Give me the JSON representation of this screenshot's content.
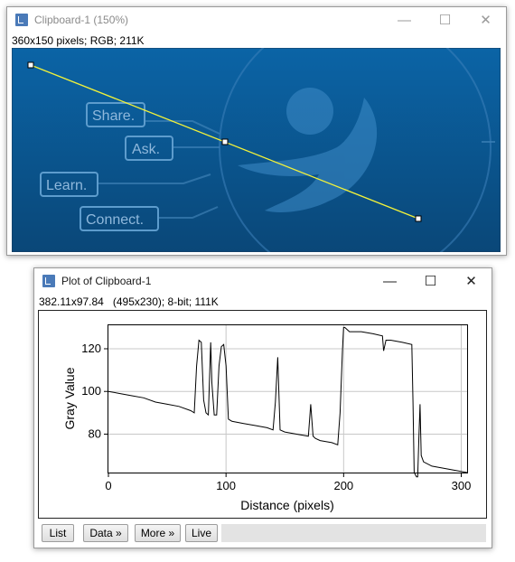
{
  "image_window": {
    "title": "Clipboard-1 (150%)",
    "info": "360x150 pixels; RGB; 211K",
    "controls": {
      "minimize": "—",
      "maximize": "☐",
      "close": "✕"
    },
    "banner": {
      "labels": [
        "Share.",
        "Ask.",
        "Learn.",
        "Connect."
      ],
      "bg_top": "#0b5e9e",
      "bg_bottom": "#0a4a80",
      "line_color": "#f2f23a"
    }
  },
  "plot_window": {
    "title": "Plot of Clipboard-1",
    "info": "382.11x97.84   (495x230); 8-bit; 111K",
    "controls": {
      "minimize": "—",
      "maximize": "☐",
      "close": "✕"
    },
    "buttons": {
      "list": "List",
      "data": "Data »",
      "more": "More »",
      "live": "Live"
    },
    "chart_data": {
      "type": "line",
      "xlabel": "Distance (pixels)",
      "ylabel": "Gray Value",
      "xlim": [
        0,
        305
      ],
      "ylim": [
        62,
        131
      ],
      "x_ticks": [
        0,
        100,
        200,
        300
      ],
      "y_ticks": [
        80,
        100,
        120
      ],
      "grid": true,
      "series": [
        {
          "x": [
            0,
            10,
            20,
            30,
            40,
            50,
            60,
            70,
            73,
            75,
            77,
            79,
            81,
            83,
            85,
            87,
            88,
            90,
            92,
            94,
            96,
            98,
            100,
            102,
            105,
            115,
            125,
            135,
            140,
            142,
            144,
            146,
            150,
            160,
            170,
            172,
            174,
            176,
            180,
            190,
            195,
            197,
            199,
            200,
            201,
            205,
            215,
            225,
            233,
            234,
            236,
            240,
            250,
            258,
            259,
            260,
            262,
            263,
            264,
            265,
            266,
            268,
            275,
            285,
            295,
            305
          ],
          "y": [
            100,
            99,
            98,
            97,
            95,
            94,
            93,
            91,
            90,
            112,
            124,
            123,
            96,
            90,
            89,
            123,
            104,
            89,
            89,
            112,
            121,
            122,
            112,
            87,
            86,
            85,
            84,
            83,
            82,
            95,
            116,
            82,
            81,
            80,
            79,
            94,
            79,
            78,
            77,
            76,
            75,
            90,
            119,
            130,
            130,
            128,
            128,
            127,
            126,
            119,
            124,
            124,
            123,
            122,
            95,
            62,
            60,
            60,
            78,
            94,
            70,
            67,
            65,
            64,
            63,
            62
          ]
        }
      ]
    }
  }
}
